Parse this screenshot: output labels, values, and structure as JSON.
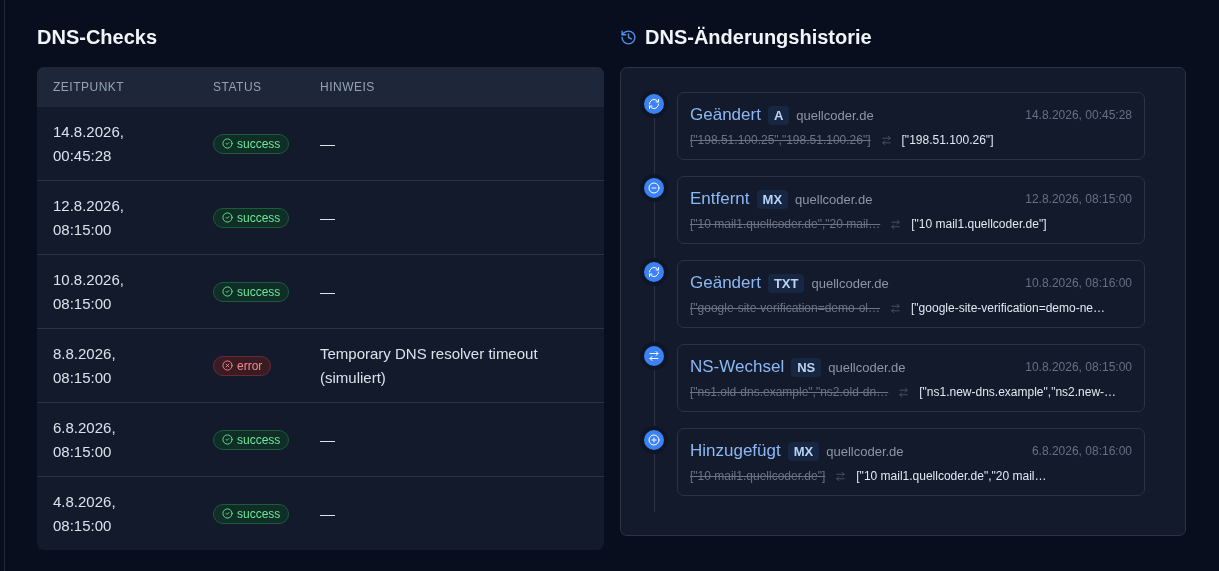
{
  "checks": {
    "title": "DNS-Checks",
    "columns": [
      "ZEITPUNKT",
      "STATUS",
      "HINWEIS"
    ],
    "rows": [
      {
        "time": "14.8.2026,\n00:45:28",
        "status": {
          "kind": "success",
          "label": "success"
        },
        "note": "—"
      },
      {
        "time": "12.8.2026,\n08:15:00",
        "status": {
          "kind": "success",
          "label": "success"
        },
        "note": "—"
      },
      {
        "time": "10.8.2026,\n08:15:00",
        "status": {
          "kind": "success",
          "label": "success"
        },
        "note": "—"
      },
      {
        "time": "8.8.2026,\n08:15:00",
        "status": {
          "kind": "error",
          "label": "error"
        },
        "note": "Temporary DNS resolver timeout (simuliert)"
      },
      {
        "time": "6.8.2026,\n08:15:00",
        "status": {
          "kind": "success",
          "label": "success"
        },
        "note": "—"
      },
      {
        "time": "4.8.2026,\n08:15:00",
        "status": {
          "kind": "success",
          "label": "success"
        },
        "note": "—"
      }
    ]
  },
  "history": {
    "title": "DNS-Änderungshistorie",
    "entries": [
      {
        "kind": "changed",
        "action": "Geändert",
        "type": "A",
        "domain": "quellcoder.de",
        "time": "14.8.2026, 00:45:28",
        "old": "[\"198.51.100.25\",\"198.51.100.26\"]",
        "new": "[\"198.51.100.26\"]"
      },
      {
        "kind": "removed",
        "action": "Entfernt",
        "type": "MX",
        "domain": "quellcoder.de",
        "time": "12.8.2026, 08:15:00",
        "old": "[\"10 mail1.quellcoder.de\",\"20 mail…",
        "new": "[\"10 mail1.quellcoder.de\"]"
      },
      {
        "kind": "changed",
        "action": "Geändert",
        "type": "TXT",
        "domain": "quellcoder.de",
        "time": "10.8.2026, 08:16:00",
        "old": "[\"google-site-verification=demo-ol…",
        "new": "[\"google-site-verification=demo-ne…"
      },
      {
        "kind": "ns",
        "action": "NS-Wechsel",
        "type": "NS",
        "domain": "quellcoder.de",
        "time": "10.8.2026, 08:15:00",
        "old": "[\"ns1.old-dns.example\",\"ns2.old-dn…",
        "new": "[\"ns1.new-dns.example\",\"ns2.new-…"
      },
      {
        "kind": "added",
        "action": "Hinzugefügt",
        "type": "MX",
        "domain": "quellcoder.de",
        "time": "6.8.2026, 08:16:00",
        "old": "[\"10 mail1.quellcoder.de\"]",
        "new": "[\"10 mail1.quellcoder.de\",\"20 mail…"
      }
    ]
  }
}
